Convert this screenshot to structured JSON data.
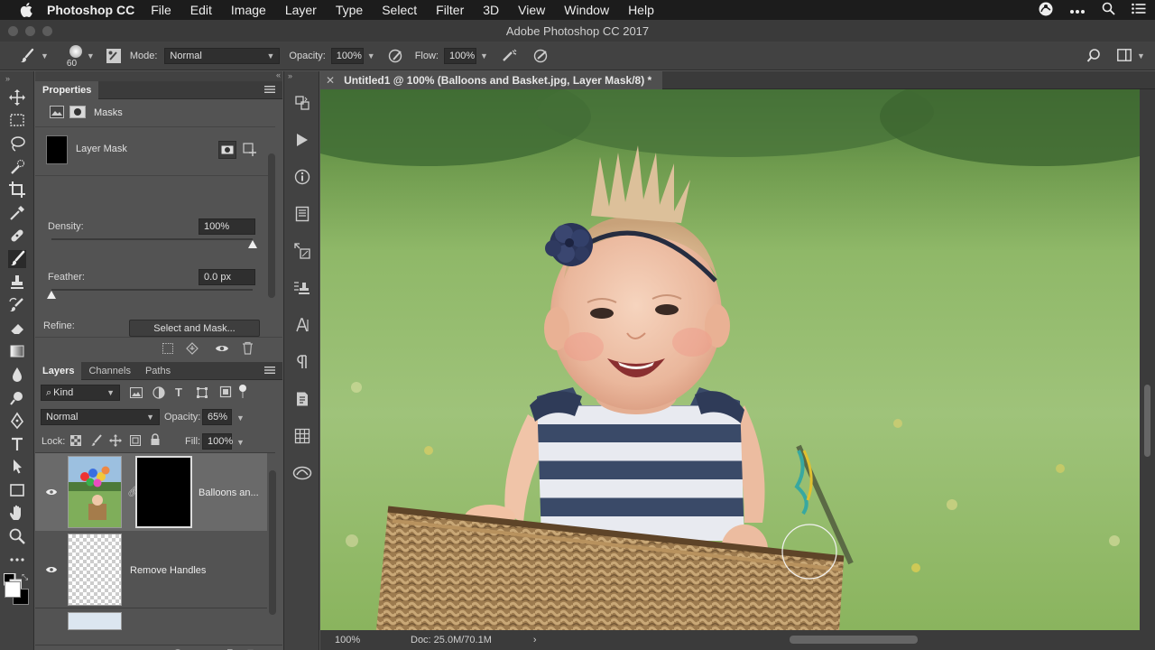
{
  "menubar": {
    "app_name": "Photoshop CC",
    "items": [
      "File",
      "Edit",
      "Image",
      "Layer",
      "Type",
      "Select",
      "Filter",
      "3D",
      "View",
      "Window",
      "Help"
    ]
  },
  "window": {
    "title": "Adobe Photoshop CC 2017"
  },
  "options_bar": {
    "brush_size": "60",
    "mode_label": "Mode:",
    "mode_value": "Normal",
    "opacity_label": "Opacity:",
    "opacity_value": "100%",
    "flow_label": "Flow:",
    "flow_value": "100%"
  },
  "properties": {
    "tab_label": "Properties",
    "section_label": "Masks",
    "mask_name": "Layer Mask",
    "density_label": "Density:",
    "density_value": "100%",
    "density_level": 1.0,
    "feather_label": "Feather:",
    "feather_value": "0.0 px",
    "feather_level": 0.0,
    "refine_label": "Refine:",
    "select_mask_button": "Select and Mask..."
  },
  "layers_panel": {
    "tabs": [
      "Layers",
      "Channels",
      "Paths"
    ],
    "filter_kind": "Kind",
    "blend_mode": "Normal",
    "opacity_label": "Opacity:",
    "opacity_value": "65%",
    "lock_label": "Lock:",
    "fill_label": "Fill:",
    "fill_value": "100%",
    "layers": [
      {
        "name": "Balloons an..."
      },
      {
        "name": "Remove Handles"
      }
    ]
  },
  "document": {
    "tab_title": "Untitled1 @ 100% (Balloons and Basket.jpg, Layer Mask/8) *",
    "zoom": "100%",
    "doc_info": "Doc: 25.0M/70.1M"
  },
  "colors": {
    "accent_selected_layer": "#6a6a6a",
    "panel_bg": "#535353",
    "chrome_dark": "#424242"
  }
}
